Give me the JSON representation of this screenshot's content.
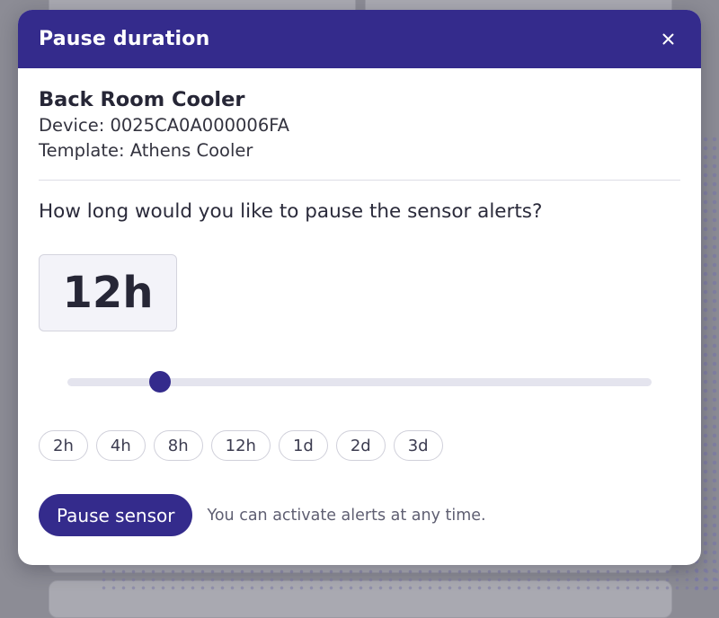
{
  "modal": {
    "title": "Pause duration",
    "close_icon": "close-icon"
  },
  "device": {
    "name": "Back Room Cooler",
    "device_line": "Device: 0025CA0A000006FA",
    "template_line": "Template: Athens Cooler"
  },
  "question": "How long would you like to pause the sensor alerts?",
  "duration": {
    "value_label": "12h",
    "slider_fraction": 0.158
  },
  "presets": [
    "2h",
    "4h",
    "8h",
    "12h",
    "1d",
    "2d",
    "3d"
  ],
  "actions": {
    "pause_label": "Pause sensor",
    "hint": "You can activate alerts at any time."
  },
  "colors": {
    "primary": "#342b8c",
    "track": "#e4e4ee"
  }
}
